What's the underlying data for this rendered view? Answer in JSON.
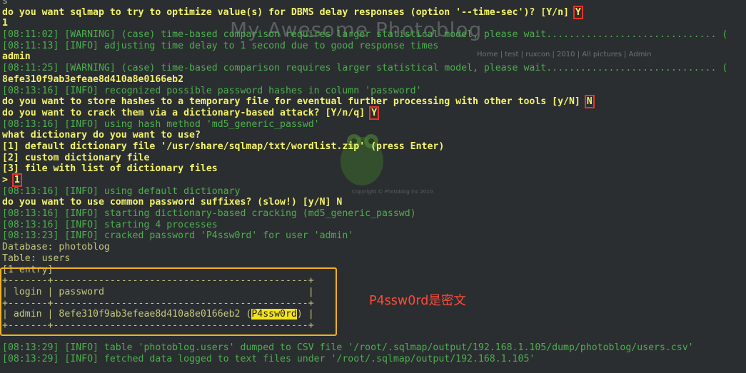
{
  "watermark": {
    "title": "My Awesome Photoblog",
    "nav": "Home | test | ruxcon | 2010 | All pictures | Admin",
    "footer": "Copyright © Photoblog inc 2010"
  },
  "lines": {
    "l0": "s",
    "l1_text": "do you want sqlmap to try to optimize value(s) for DBMS delay responses (option '--time-sec')? [Y/n] ",
    "l1_answer": "Y",
    "l2": "1",
    "l3": "[08:11:02] [WARNING] (case) time-based comparison requires larger statistical model, please wait.............................. (",
    "l4": "[08:11:13] [INFO] adjusting time delay to 1 second due to good response times",
    "l5": "admin",
    "l6": "[08:11:25] [WARNING] (case) time-based comparison requires larger statistical model, please wait.............................. (",
    "l7": "8efe310f9ab3efeae8d410a8e0166eb2",
    "l8": "[08:13:16] [INFO] recognized possible password hashes in column 'password'",
    "l9_text": "do you want to store hashes to a temporary file for eventual further processing with other tools [y/N] ",
    "l9_answer": "N",
    "l10_text": "do you want to crack them via a dictionary-based attack? [Y/n/q] ",
    "l10_answer": "Y",
    "l11": "[08:13:16] [INFO] using hash method 'md5_generic_passwd'",
    "l12": "what dictionary do you want to use?",
    "l13": "[1] default dictionary file '/usr/share/sqlmap/txt/wordlist.zip' (press Enter)",
    "l14": "[2] custom dictionary file",
    "l15": "[3] file with list of dictionary files",
    "l16_prompt": "> ",
    "l16_answer": "1",
    "l17": "[08:13:16] [INFO] using default dictionary",
    "l18": "do you want to use common password suffixes? (slow!) [y/N] N",
    "l19": "[08:13:16] [INFO] starting dictionary-based cracking (md5_generic_passwd)",
    "l20": "[08:13:16] [INFO] starting 4 processes",
    "l21": "[08:13:23] [INFO] cracked password 'P4ssw0rd' for user 'admin'",
    "l22": "Database: photoblog",
    "l23": "Table: users",
    "l24": "[1 entry]",
    "l25": "+-------+---------------------------------------------+",
    "l26": "| login | password                                    |",
    "l27": "+-------+---------------------------------------------+",
    "l28_pre": "| admin | 8efe310f9ab3efeae8d410a8e0166eb2 (",
    "l28_pw": "P4ssw0rd",
    "l28_post": ") |",
    "l29": "+-------+---------------------------------------------+",
    "l30": "",
    "l31": "[08:13:29] [INFO] table 'photoblog.users' dumped to CSV file '/root/.sqlmap/output/192.168.1.105/dump/photoblog/users.csv'",
    "l32": "[08:13:29] [INFO] fetched data logged to text files under '/root/.sqlmap/output/192.168.1.105'"
  },
  "annotation": {
    "note": "P4ssw0rd是密文"
  },
  "colors": {
    "background": "#2b2e30",
    "prompt_yellow": "#f3f36a",
    "info_green": "#4caf4f",
    "red_box": "#e8342a",
    "orange_frame": "#f2b21b",
    "note_red": "#ff4b39",
    "highlight": "#f4e31a"
  }
}
